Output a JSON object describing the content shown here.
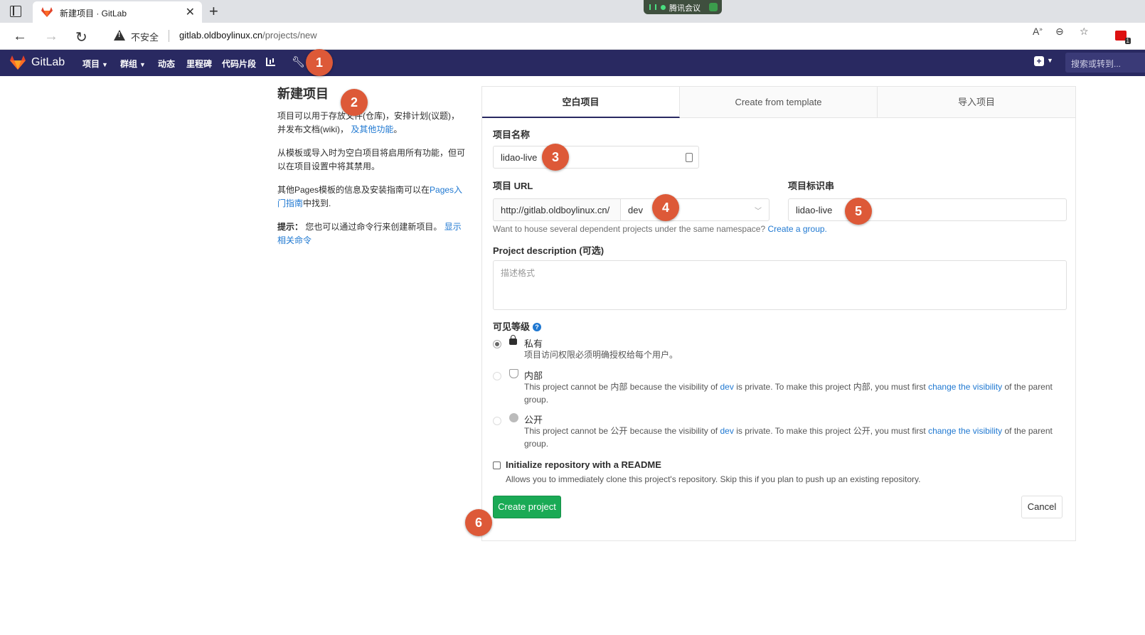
{
  "browser": {
    "tab_title": "新建项目 · GitLab",
    "new_tab": "+",
    "meeting_label": "腾讯会议",
    "insecure_label": "不安全",
    "url_host": "gitlab.oldboylinux.cn",
    "url_path": "/projects/new",
    "ext_badge_count": "1"
  },
  "gitlab_header": {
    "brand": "GitLab",
    "nav": [
      "项目",
      "群组",
      "动态",
      "里程碑",
      "代码片段"
    ],
    "search_placeholder": "搜索或转到..."
  },
  "left": {
    "title": "新建项目",
    "p1": "项目可以用于存放文件(仓库)，安排计划(议题)，并发布文档(wiki)，",
    "p1_link": "及其他功能",
    "p1_end": "。",
    "p2": "从模板或导入时为空白项目将启用所有功能，但可以在项目设置中将其禁用。",
    "p3": "其他Pages模板的信息及安装指南可以在",
    "p3_link": "Pages入门指南",
    "p3_end": "中找到.",
    "p4_bold": "提示：",
    "p4": "您也可以通过命令行来创建新项目。",
    "p4_link": "显示相关命令"
  },
  "tabs": [
    "空白项目",
    "Create from template",
    "导入项目"
  ],
  "form": {
    "project_name_label": "项目名称",
    "project_name_value": "lidao-live",
    "project_url_label": "项目 URL",
    "url_prefix": "http://gitlab.oldboylinux.cn/",
    "namespace": "dev",
    "slug_label": "项目标识串",
    "slug_value": "lidao-live",
    "group_hint": "Want to house several dependent projects under the same namespace?",
    "group_hint_link": "Create a group.",
    "desc_label": "Project description (可选)",
    "desc_placeholder": "描述格式",
    "visibility_label": "可见等级",
    "visibility": [
      {
        "title": "私有",
        "desc": "项目访问权限必须明确授权给每个用户。"
      },
      {
        "title": "内部",
        "desc_a": "This project cannot be 内部 because the visibility of",
        "desc_link1": "dev",
        "desc_b": "is private. To make this project 内部, you must first",
        "desc_link2": "change the visibility",
        "desc_c": "of the parent group."
      },
      {
        "title": "公开",
        "desc_a": "This project cannot be 公开 because the visibility of",
        "desc_link1": "dev",
        "desc_b": "is private. To make this project 公开, you must first",
        "desc_link2": "change the visibility",
        "desc_c": "of the parent group."
      }
    ],
    "readme_label": "Initialize repository with a README",
    "readme_desc": "Allows you to immediately clone this project's repository. Skip this if you plan to push up an existing repository.",
    "create_button": "Create project",
    "cancel_button": "Cancel"
  },
  "markers": [
    "1",
    "2",
    "3",
    "4",
    "5",
    "6"
  ],
  "colors": {
    "header_bg": "#292961",
    "create_btn": "#1aaa55",
    "link": "#1f78d1",
    "marker": "#dd5938"
  }
}
